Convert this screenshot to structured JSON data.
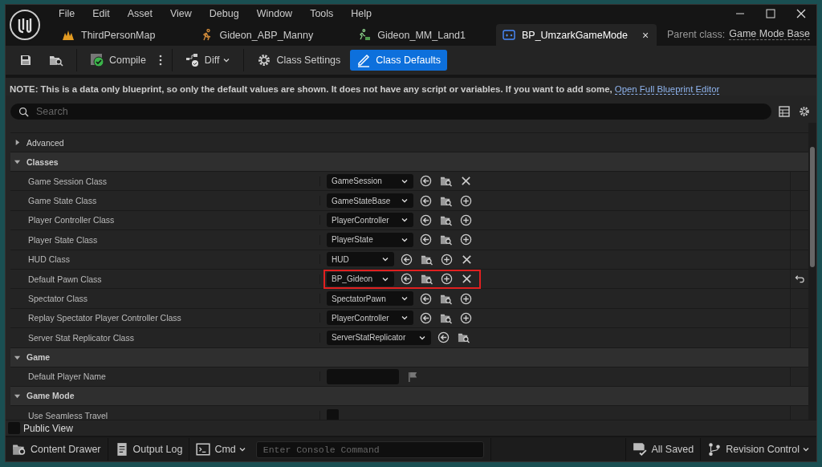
{
  "menu": [
    "File",
    "Edit",
    "Asset",
    "View",
    "Debug",
    "Window",
    "Tools",
    "Help"
  ],
  "tabs": [
    {
      "label": "ThirdPersonMap",
      "kind": "map",
      "selected": false
    },
    {
      "label": "Gideon_ABP_Manny",
      "kind": "anim",
      "selected": false
    },
    {
      "label": "Gideon_MM_Land1",
      "kind": "motion",
      "selected": false
    },
    {
      "label": "BP_UmzarkGameMode",
      "kind": "gamemode",
      "selected": true,
      "close": "×"
    }
  ],
  "parent_class": {
    "label": "Parent class:",
    "value": "Game Mode Base"
  },
  "toolbar": [
    {
      "label": "Compile",
      "kind": "compile",
      "selected": false
    },
    {
      "label": "Diff",
      "kind": "diff",
      "selected": false
    },
    {
      "label": "Class Settings",
      "kind": "settings",
      "selected": false
    },
    {
      "label": "Class Defaults",
      "kind": "defaults",
      "selected": true
    }
  ],
  "note": {
    "text": "NOTE: This is a data only blueprint, so only the default values are shown.  It does not have any script or variables.  If you want to add some,",
    "link": "Open Full Blueprint Editor"
  },
  "search": {
    "placeholder": "Search"
  },
  "properties": [
    {
      "kind": "cutoff"
    },
    {
      "kind": "category",
      "label": "Advanced",
      "expanded": false
    },
    {
      "kind": "category",
      "label": "Classes",
      "expanded": true
    },
    {
      "kind": "class",
      "label": "Game Session Class",
      "value": "GameSession",
      "actions": [
        {
          "kind": "use"
        },
        {
          "kind": "browse"
        },
        {
          "kind": "clear"
        }
      ],
      "highlighted": false,
      "modified": false
    },
    {
      "kind": "class",
      "label": "Game State Class",
      "value": "GameStateBase",
      "actions": [
        {
          "kind": "use"
        },
        {
          "kind": "browse"
        },
        {
          "kind": "add"
        }
      ],
      "highlighted": false,
      "modified": false
    },
    {
      "kind": "class",
      "label": "Player Controller Class",
      "value": "PlayerController",
      "actions": [
        {
          "kind": "use"
        },
        {
          "kind": "browse"
        },
        {
          "kind": "add"
        }
      ],
      "highlighted": false,
      "modified": false
    },
    {
      "kind": "class",
      "label": "Player State Class",
      "value": "PlayerState",
      "actions": [
        {
          "kind": "use"
        },
        {
          "kind": "browse"
        },
        {
          "kind": "add"
        }
      ],
      "highlighted": false,
      "modified": false
    },
    {
      "kind": "class",
      "label": "HUD Class",
      "value": "HUD",
      "actions": [
        {
          "kind": "use"
        },
        {
          "kind": "browse"
        },
        {
          "kind": "add"
        },
        {
          "kind": "clear"
        }
      ],
      "highlighted": false,
      "modified": false
    },
    {
      "kind": "class",
      "label": "Default Pawn Class",
      "value": "BP_Gideon",
      "actions": [
        {
          "kind": "use"
        },
        {
          "kind": "browse"
        },
        {
          "kind": "add"
        },
        {
          "kind": "clear"
        }
      ],
      "highlighted": true,
      "modified": true
    },
    {
      "kind": "class",
      "label": "Spectator Class",
      "value": "SpectatorPawn",
      "actions": [
        {
          "kind": "use"
        },
        {
          "kind": "browse"
        },
        {
          "kind": "add"
        }
      ],
      "highlighted": false,
      "modified": false
    },
    {
      "kind": "class",
      "label": "Replay Spectator Player Controller Class",
      "value": "PlayerController",
      "actions": [
        {
          "kind": "use"
        },
        {
          "kind": "browse"
        },
        {
          "kind": "add"
        }
      ],
      "highlighted": false,
      "modified": false
    },
    {
      "kind": "class",
      "label": "Server Stat Replicator Class",
      "value": "ServerStatReplicator",
      "actions": [
        {
          "kind": "use"
        },
        {
          "kind": "browse"
        }
      ],
      "highlighted": false,
      "modified": false
    },
    {
      "kind": "category",
      "label": "Game",
      "expanded": true
    },
    {
      "kind": "text",
      "label": "Default Player Name"
    },
    {
      "kind": "category",
      "label": "Game Mode",
      "expanded": true
    },
    {
      "kind": "checkbox",
      "label": "Use Seamless Travel",
      "checked": false
    }
  ],
  "public_view": {
    "label": "Public View",
    "checked": false
  },
  "status_bar": {
    "content_drawer": "Content Drawer",
    "output_log": "Output Log",
    "cmd": "Cmd",
    "console_placeholder": "Enter Console Command",
    "saved": "All Saved",
    "revision": "Revision Control"
  }
}
